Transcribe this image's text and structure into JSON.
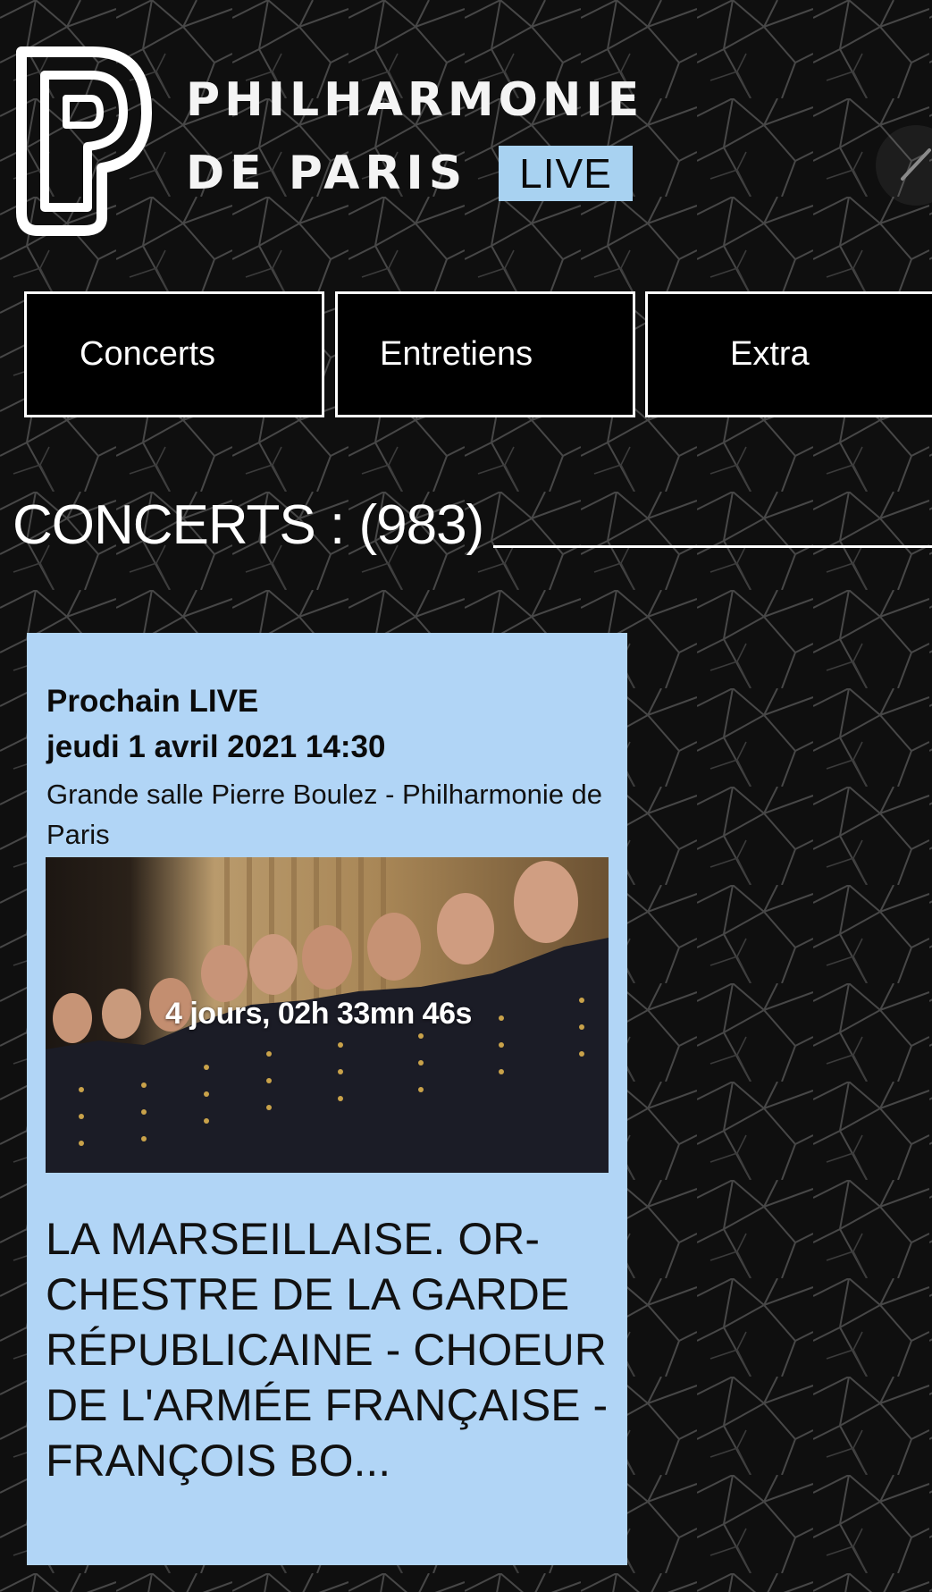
{
  "header": {
    "brand_line1": "PHILHARMONIE",
    "brand_line2": "DE PARIS",
    "live_badge": "LIVE",
    "logo_icon": "philharmonie-p-logo",
    "edit_icon": "pencil-icon"
  },
  "nav": {
    "tabs": [
      {
        "label": "Concerts"
      },
      {
        "label": "Entretiens"
      },
      {
        "label": "Extra"
      }
    ]
  },
  "section": {
    "title": "CONCERTS : (983)"
  },
  "next_live": {
    "label": "Prochain LIVE",
    "date": "jeudi 1 avril 2021 14:30",
    "venue": "Grande salle Pierre Boulez - Philharmonie de Paris",
    "countdown": "4 jours,  02h 33mn 46s",
    "title": "LA MARSEILLAISE. OR-CHESTRE DE LA GARDE RÉPUBLICAINE - CHOEUR DE L'ARMÉE FRANÇAISE - FRANÇOIS BO..."
  },
  "colors": {
    "background": "#0f0f0f",
    "accent_light_blue": "#b1d5f6",
    "live_badge": "#a8d2f1",
    "text_light": "#ffffff",
    "text_dark": "#111111"
  }
}
